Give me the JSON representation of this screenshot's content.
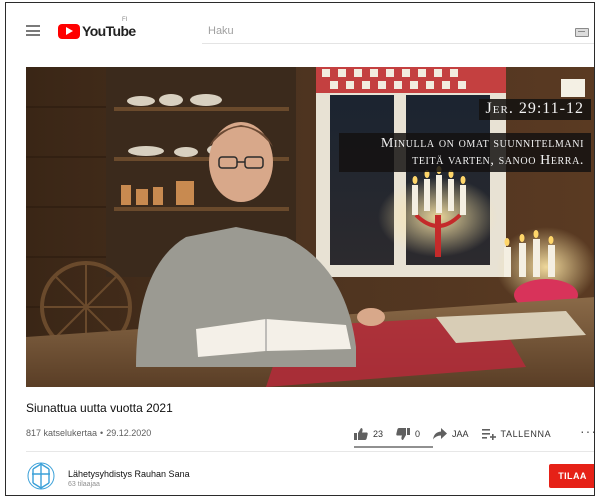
{
  "header": {
    "logo_text": "YouTube",
    "logo_superscript": "FI",
    "search_placeholder": "Haku"
  },
  "video": {
    "caption_reference": "Jer. 29:11-12",
    "caption_lines": [
      "Minulla on omat suunnitelmani",
      "teitä varten, sanoo Herra."
    ],
    "title": "Siunattua uutta vuotta 2021",
    "views": "817 katselukertaa",
    "date": "29.12.2020",
    "separator": "•"
  },
  "actions": {
    "likes": "23",
    "dislikes": "0",
    "share_label": "JAA",
    "save_label": "TALLENNA",
    "more_label": "···",
    "like_ratio": 1.0
  },
  "channel": {
    "name": "Lähetysyhdistys Rauhan Sana",
    "subscribers": "63 tilaajaa",
    "subscribe_label": "TILAA"
  },
  "colors": {
    "brand_red": "#ff0000",
    "subscribe_red": "#e62117",
    "avatar_blue": "#3aa0d8"
  }
}
